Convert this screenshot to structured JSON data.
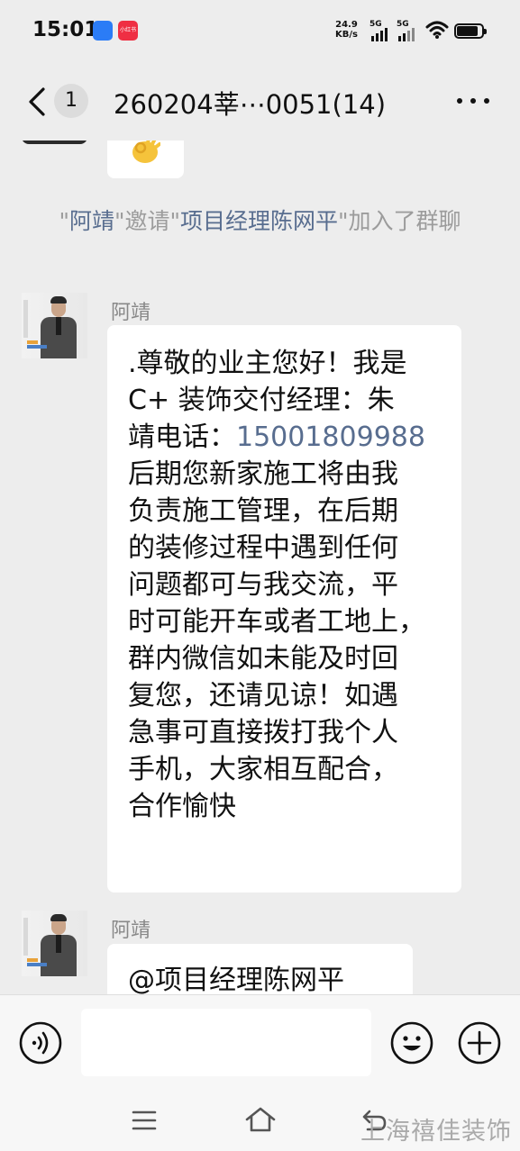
{
  "status_bar": {
    "time": "15:01",
    "app_badge_2_text": "小红书",
    "net_speed_value": "24.9",
    "net_speed_unit": "KB/s",
    "signal_1": "5G",
    "signal_2": "5G"
  },
  "header": {
    "unread_count": "1",
    "title": "260204莘⋯0051(14)"
  },
  "messages": {
    "system": {
      "inviter": "阿靖",
      "invite_verb": "邀请",
      "invitee": "项目经理陈网平",
      "joined": "加入了群聊"
    },
    "msg1": {
      "sender": "阿靖",
      "lines": [
        ".尊敬的业主您好！我是",
        "C+ 装饰交付经理：朱",
        "靖电话：",
        "后期您新家施工将由我",
        "负责施工管理，在后期",
        "的装修过程中遇到任何",
        "问题都可与我交流，平",
        "时可能开车或者工地上，",
        "群内微信如未能及时回",
        "复您，还请见谅！如遇",
        "急事可直接拨打我个人",
        "手机，大家相互配合，",
        "合作愉快"
      ],
      "phone": "15001809988"
    },
    "msg2": {
      "sender": "阿靖",
      "text": "@项目经理陈网平"
    }
  },
  "watermark": "上海禧佳装饰",
  "colors": {
    "background": "#ededed",
    "bubble": "#ffffff",
    "link": "#586d8f",
    "system_text": "#9c9c9c"
  }
}
